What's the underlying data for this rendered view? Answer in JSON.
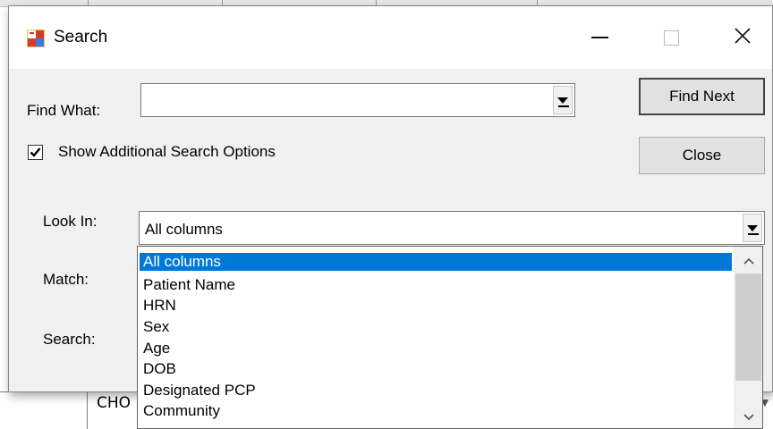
{
  "dialog": {
    "title": "Search",
    "find_what_label": "Find What:",
    "find_what_value": "",
    "find_next_label": "Find Next",
    "close_label": "Close",
    "show_options_label": "Show Additional Search Options",
    "show_options_checked": true,
    "look_in_label": "Look In:",
    "look_in_value": "All columns",
    "match_label": "Match:",
    "search_label": "Search:"
  },
  "dropdown": {
    "items": [
      "All columns",
      "Patient Name",
      "HRN",
      "Sex",
      "Age",
      "DOB",
      "Designated PCP",
      "Community"
    ],
    "selected_index": 0
  },
  "background": {
    "cell_text": "CHO"
  },
  "icons": {
    "app": "search-window-icon",
    "minimize": "minimize-icon",
    "maximize": "maximize-icon",
    "close": "close-icon",
    "dropdown_arrow": "chevron-down-icon",
    "scroll_up": "chevron-up-icon",
    "scroll_down": "chevron-down-icon",
    "check": "check-icon"
  },
  "colors": {
    "selection": "#0078d7",
    "dialog_bg": "#f0f0f0",
    "titlebar_bg": "#ffffff"
  }
}
